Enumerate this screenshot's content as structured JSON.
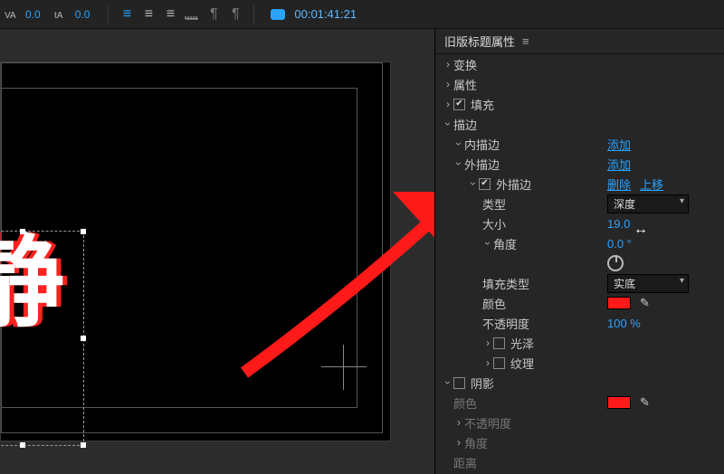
{
  "toolbar": {
    "kerning_value": "0.0",
    "leading_value": "0.0",
    "timecode": "00:01:41:21"
  },
  "canvas": {
    "title_text": "静"
  },
  "panel": {
    "title": "旧版标题属性",
    "sections": {
      "transform": "变换",
      "properties": "属性",
      "fill": "填充",
      "stroke": "描边",
      "inner_stroke": "内描边",
      "outer_stroke": "外描边",
      "outer_stroke_item": "外描边",
      "type": "类型",
      "size": "大小",
      "angle": "角度",
      "fill_type": "填充类型",
      "color": "颜色",
      "opacity": "不透明度",
      "sheen": "光泽",
      "texture": "纹理",
      "shadow": "阴影",
      "shadow_color": "颜色",
      "shadow_opacity": "不透明度",
      "shadow_angle": "角度",
      "shadow_distance": "距离"
    },
    "actions": {
      "add": "添加",
      "delete": "删除",
      "move_up": "上移"
    },
    "values": {
      "type_select": "深度",
      "size": "19.0",
      "angle": "0.0 °",
      "fill_type_select": "实底",
      "opacity": "100 %",
      "shadow_color_hex": "#ff1a1a"
    }
  }
}
